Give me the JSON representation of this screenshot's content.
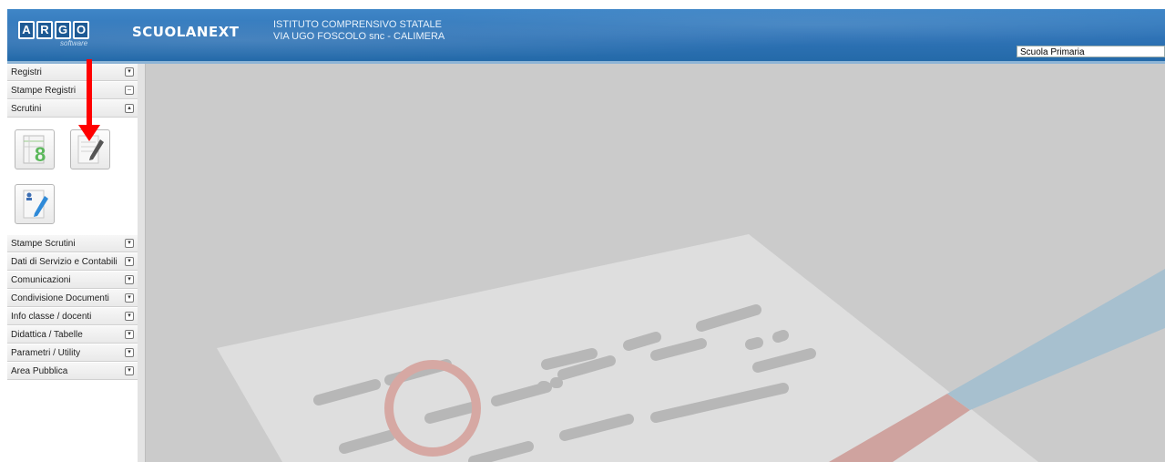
{
  "header": {
    "logo_letters": [
      "A",
      "R",
      "G",
      "O"
    ],
    "logo_sub": "software",
    "brand": "SCUOLANEXT",
    "school_line1": "ISTITUTO COMPRENSIVO STATALE",
    "school_line2": "VIA UGO FOSCOLO snc - CALIMERA",
    "school_select": "Scuola Primaria"
  },
  "sidebar": {
    "items": [
      {
        "label": "Registri",
        "toggle": "▾"
      },
      {
        "label": "Stampe Registri",
        "toggle": "–"
      },
      {
        "label": "Scrutini",
        "toggle": "▴"
      },
      {
        "label": "Stampe Scrutini",
        "toggle": "▾"
      },
      {
        "label": "Dati di Servizio e Contabili",
        "toggle": "▾"
      },
      {
        "label": "Comunicazioni",
        "toggle": "▾"
      },
      {
        "label": "Condivisione Documenti",
        "toggle": "▾"
      },
      {
        "label": "Info classe / docenti",
        "toggle": "▾"
      },
      {
        "label": "Didattica / Tabelle",
        "toggle": "▾"
      },
      {
        "label": "Parametri / Utility",
        "toggle": "▾"
      },
      {
        "label": "Area Pubblica",
        "toggle": "▾"
      }
    ],
    "scrutini_tiles": [
      {
        "icon": "grades-sheet-icon",
        "text": "8"
      },
      {
        "icon": "edit-document-icon"
      },
      {
        "icon": "student-edit-icon"
      }
    ]
  },
  "colors": {
    "header_blue": "#2f73b6",
    "background_gray": "#cdcdcd",
    "arrow_red": "#ff0000"
  }
}
